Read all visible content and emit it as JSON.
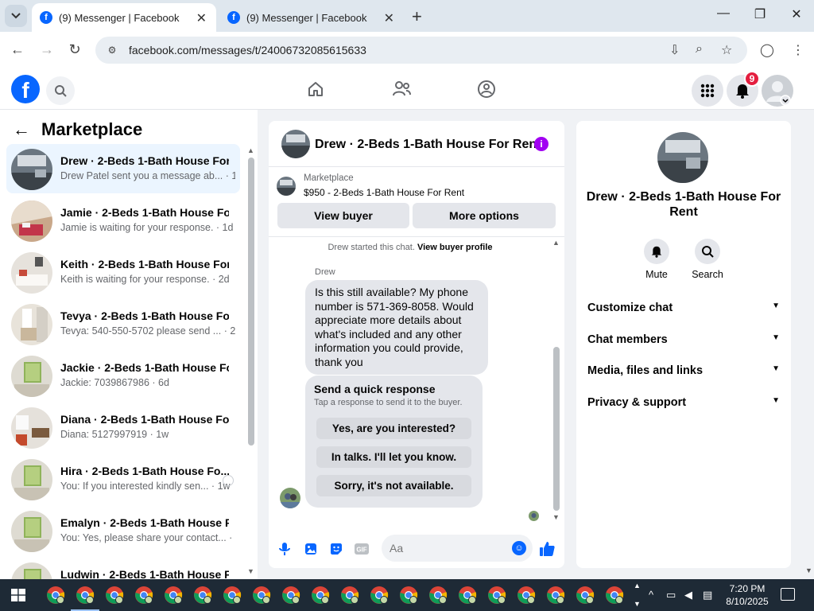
{
  "browser": {
    "tabs": [
      {
        "title": "(9) Messenger | Facebook",
        "active": true
      },
      {
        "title": "(9) Messenger | Facebook",
        "active": false
      }
    ],
    "url": "facebook.com/messages/t/24006732085615633"
  },
  "header": {
    "notification_count": "9"
  },
  "left_panel": {
    "title": "Marketplace",
    "conversations": [
      {
        "name": "Drew · 2-Beds 1-Bath House For ...",
        "snippet": "Drew Patel sent you a message ab... · 1m",
        "active": true
      },
      {
        "name": "Jamie · 2-Beds 1-Bath House For...",
        "snippet": "Jamie is waiting for your response. · 1d"
      },
      {
        "name": "Keith · 2-Beds 1-Bath House For ...",
        "snippet": "Keith is waiting for your response. · 2d"
      },
      {
        "name": "Tevya · 2-Beds 1-Bath House For...",
        "snippet": "Tevya: 540-550-5702 please send ... · 2d"
      },
      {
        "name": "Jackie · 2-Beds 1-Bath House Fo...",
        "snippet": "Jackie: 7039867986 · 6d"
      },
      {
        "name": "Diana · 2-Beds 1-Bath House For...",
        "snippet": "Diana: 5127997919 · 1w"
      },
      {
        "name": "Hira · 2-Beds 1-Bath House Fo...",
        "snippet": "You: If you interested kindly sen... · 1w"
      },
      {
        "name": "Emalyn · 2-Beds 1-Bath House F...",
        "snippet": "You: Yes, please share your contact... · 1w"
      },
      {
        "name": "Ludwin · 2-Beds 1-Bath House F...",
        "snippet": ""
      }
    ]
  },
  "chat": {
    "title": "Drew · 2-Beds 1-Bath House For Rent",
    "marketplace_label": "Marketplace",
    "listing": "$950 - 2-Beds 1-Bath House For Rent",
    "view_buyer": "View buyer",
    "more_options": "More options",
    "started_text": "Drew started this chat.",
    "view_profile": "View buyer profile",
    "sender": "Drew",
    "message": "Is this still available? My phone number is 571-369-8058. Would appreciate more details about what's included and any other information you could provide, thank you",
    "quick_title": "Send a quick response",
    "quick_sub": "Tap a response to send it to the buyer.",
    "quick_responses": [
      "Yes, are you interested?",
      "In talks. I'll let you know.",
      "Sorry, it's not available."
    ],
    "composer_placeholder": "Aa"
  },
  "right_panel": {
    "name": "Drew · 2-Beds 1-Bath House For Rent",
    "mute": "Mute",
    "search": "Search",
    "sections": [
      "Customize chat",
      "Chat members",
      "Media, files and links",
      "Privacy & support"
    ]
  },
  "taskbar": {
    "time": "7:20 PM",
    "date": "8/10/2025"
  },
  "colors": {
    "fb_blue": "#0866ff",
    "messenger_blue": "#0866ff",
    "info_purple": "#a100f2",
    "badge_red": "#e41e3f"
  }
}
